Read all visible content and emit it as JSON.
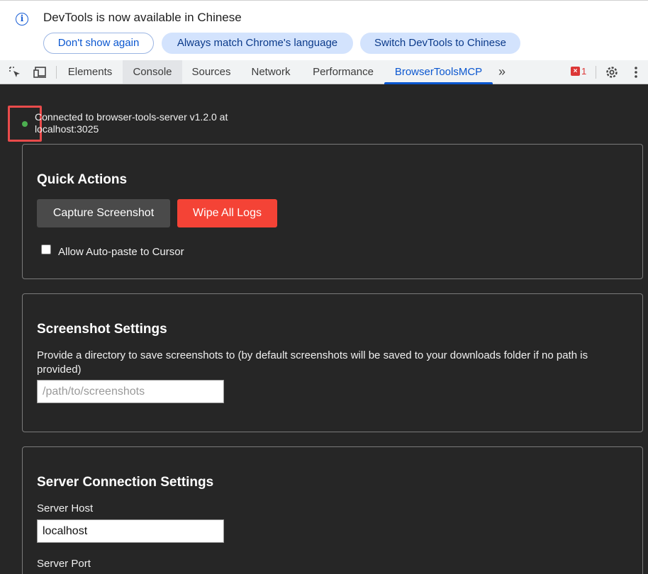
{
  "infobar": {
    "icon": "info-icon",
    "message": "DevTools is now available in Chinese",
    "buttons": {
      "dont_show": "Don't show again",
      "always_match": "Always match Chrome's language",
      "switch": "Switch DevTools to Chinese"
    }
  },
  "toolbar": {
    "tabs": [
      "Elements",
      "Console",
      "Sources",
      "Network",
      "Performance",
      "BrowserToolsMCP"
    ],
    "selected_tab": "BrowserToolsMCP",
    "more": "»",
    "error_count": "1"
  },
  "status": {
    "text": "Connected to browser-tools-server v1.2.0 at localhost:3025",
    "color": "#4caf50"
  },
  "quick_actions": {
    "title": "Quick Actions",
    "capture_label": "Capture Screenshot",
    "wipe_label": "Wipe All Logs",
    "autopaste_label": "Allow Auto-paste to Cursor",
    "autopaste_checked": false
  },
  "screenshot_settings": {
    "title": "Screenshot Settings",
    "description": "Provide a directory to save screenshots to (by default screenshots will be saved to your downloads folder if no path is provided)",
    "path_placeholder": "/path/to/screenshots",
    "path_value": ""
  },
  "server_settings": {
    "title": "Server Connection Settings",
    "host_label": "Server Host",
    "host_value": "localhost",
    "port_label": "Server Port"
  },
  "colors": {
    "accent": "#0b57d0",
    "danger": "#f44336",
    "panel_bg": "#262626"
  }
}
